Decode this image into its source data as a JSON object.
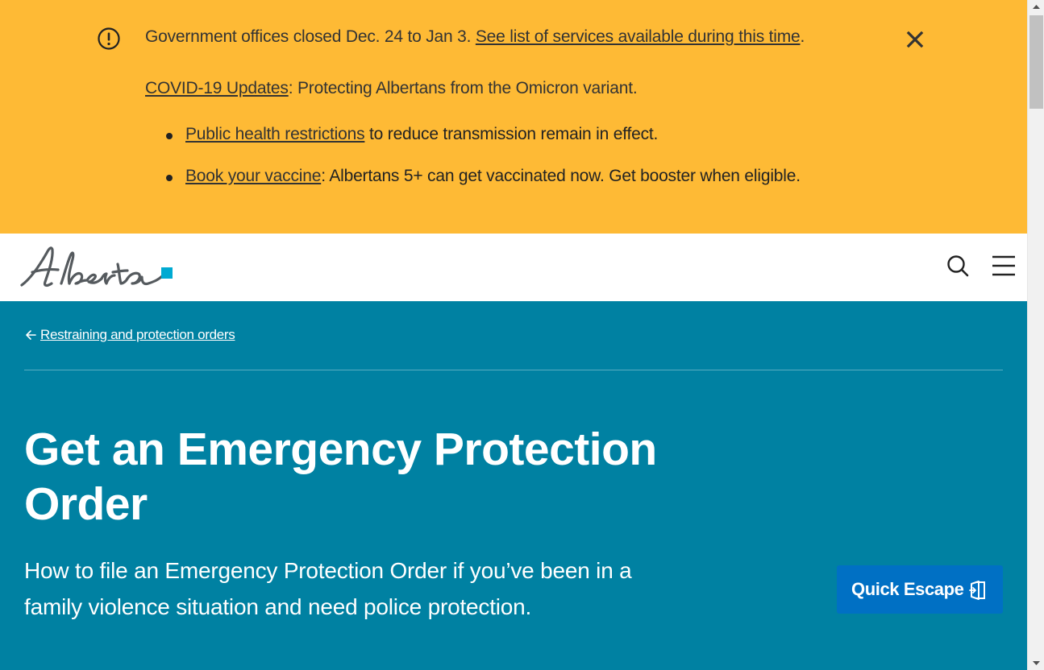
{
  "alert": {
    "notice_text": "Government offices closed Dec. 24 to Jan 3. ",
    "notice_link": "See list of services available during this time",
    "notice_end": ".",
    "covid_link": "COVID-19 Updates",
    "covid_text": ": Protecting Albertans from the Omicron variant.",
    "items": [
      {
        "link": "Public health restrictions",
        "text": " to reduce transmission remain in effect."
      },
      {
        "link": "Book your vaccine",
        "text": ": Albertans 5+ can get vaccinated now. Get booster when eligible."
      }
    ],
    "background": "#feba35"
  },
  "header": {
    "logo_text": "Alberta",
    "icons": [
      "search-icon",
      "menu-icon"
    ]
  },
  "hero": {
    "breadcrumb": "Restraining and protection orders",
    "title": "Get an Emergency Protection Order",
    "lead": "How to file an Emergency Protection Order if you’ve been in a family violence situation and need police protection.",
    "quick_escape": "Quick Escape",
    "background": "#0081a2",
    "button_color": "#0070c4"
  }
}
